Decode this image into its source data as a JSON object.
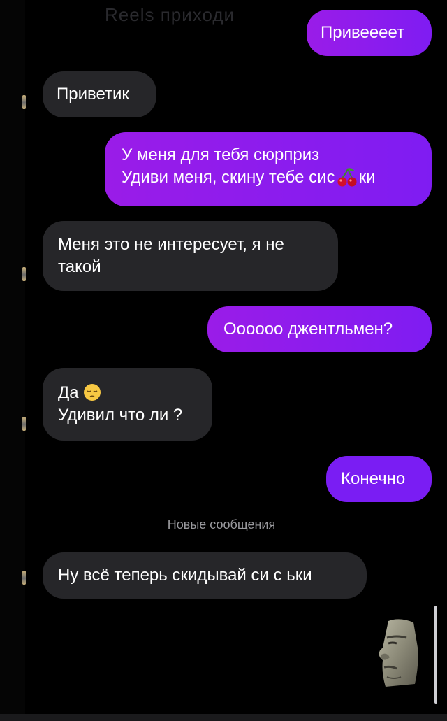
{
  "header": {
    "ghost_title": "Reels  приходи"
  },
  "messages": {
    "m1": {
      "direction": "outgoing",
      "text": "Привеееет"
    },
    "m2": {
      "direction": "incoming",
      "text": "Приветик"
    },
    "m3": {
      "direction": "outgoing",
      "line1": "У меня для тебя сюрприз",
      "line2_before": "Удиви меня, скину тебе сис",
      "emoji": "cherry-emoji",
      "line2_after": "ки"
    },
    "m4": {
      "direction": "incoming",
      "line1": "Меня это не интересует, я не",
      "line2": "такой"
    },
    "m5": {
      "direction": "outgoing",
      "text": "Оооооо джентльмен?"
    },
    "m6": {
      "direction": "incoming",
      "line1": "Да",
      "emoji": "pensive-face-emoji",
      "line2": "Удивил что ли ?"
    },
    "m7": {
      "direction": "outgoing",
      "text": "Конечно"
    },
    "m8": {
      "direction": "incoming",
      "text": "Ну всё теперь скидывай си с ьки"
    }
  },
  "divider": {
    "label": "Новые сообщения"
  },
  "sticker": {
    "icon": "moai-sticker-icon"
  },
  "colors": {
    "outgoing_bubble": "#8e18f0",
    "incoming_bubble": "#262629",
    "background": "#000000"
  }
}
